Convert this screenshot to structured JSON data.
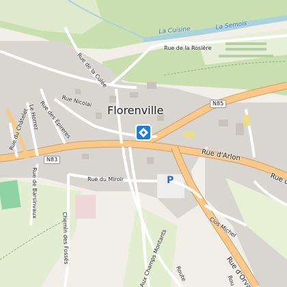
{
  "map": {
    "town": "Florenville",
    "colors": {
      "background": "#f2efe9",
      "builtup": "#d9d6d1",
      "forest": "#c9dfb0",
      "water": "#aad3df",
      "major_road": "#f8c98a",
      "minor_road": "#ffffff",
      "marker": "#1c7fd6",
      "pitch": "#8fd3a4"
    },
    "water_labels": {
      "cuisine": "La Cuisine",
      "semois": "La Semois"
    },
    "road_shields": {
      "n85": "N85",
      "n83": "N83"
    },
    "streets": {
      "rosiere": "Rue de la Rosière",
      "culee": "Rue de la Culée",
      "nicolai": "Rue Nicolai",
      "epireres": "Rue des Épireres",
      "horrez": "Le Horrez",
      "chatelet": "Rue du Châtelet",
      "barsinvaux": "Rue de Barsinvaux",
      "miroir": "Rue du Miroir",
      "arlon_1": "Rue d'Arlon",
      "arlon_2": "Rue d",
      "fosses": "Chemin des Fossés",
      "champs_montants": "Aux Champs Montants",
      "route": "Route",
      "clos_michel": "Clos Michel",
      "orval": "Rue d'Orval",
      "rou": "Rou"
    },
    "icons": {
      "marker": "directions-marker-icon",
      "parking": "P"
    }
  }
}
